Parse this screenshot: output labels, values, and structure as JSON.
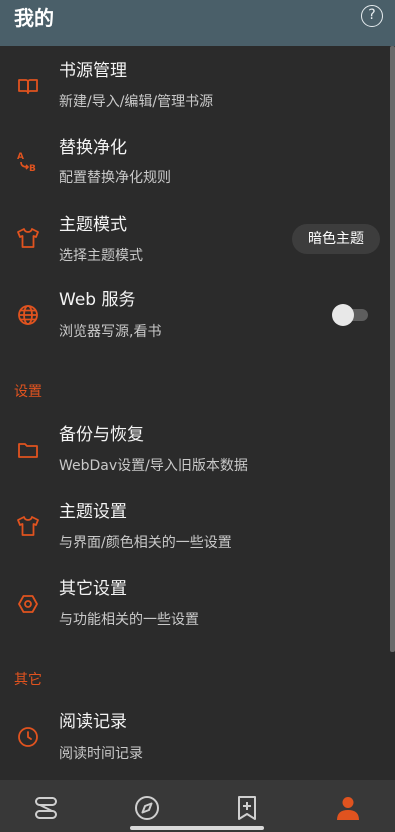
{
  "header": {
    "title": "我的",
    "help_icon": "help-circle-icon",
    "help_glyph": "?"
  },
  "items": [
    {
      "id": "book-source",
      "title": "书源管理",
      "subtitle": "新建/导入/编辑/管理书源",
      "icon": "book-icon"
    },
    {
      "id": "replace-purify",
      "title": "替换净化",
      "subtitle": "配置替换净化规则",
      "icon": "replace-ab-icon"
    },
    {
      "id": "theme-mode",
      "title": "主题模式",
      "subtitle": "选择主题模式",
      "icon": "shirt-icon",
      "value": "暗色主题"
    },
    {
      "id": "web-service",
      "title": "Web 服务",
      "subtitle": "浏览器写源,看书",
      "icon": "globe-icon",
      "toggle": false
    }
  ],
  "sections": {
    "settings": "设置",
    "other": "其它"
  },
  "settings_items": [
    {
      "id": "backup",
      "title": "备份与恢复",
      "subtitle": "WebDav设置/导入旧版本数据",
      "icon": "folder-icon"
    },
    {
      "id": "theme-settings",
      "title": "主题设置",
      "subtitle": "与界面/颜色相关的一些设置",
      "icon": "shirt-icon"
    },
    {
      "id": "other-settings",
      "title": "其它设置",
      "subtitle": "与功能相关的一些设置",
      "icon": "hexagon-settings-icon"
    }
  ],
  "other_items": [
    {
      "id": "read-record",
      "title": "阅读记录",
      "subtitle": "阅读时间记录",
      "icon": "clock-icon"
    }
  ],
  "bottom_nav": [
    {
      "id": "bookshelf",
      "icon": "bookshelf-icon",
      "active": false
    },
    {
      "id": "discover",
      "icon": "compass-icon",
      "active": false
    },
    {
      "id": "rss",
      "icon": "bookmark-add-icon",
      "active": false
    },
    {
      "id": "mine",
      "icon": "person-icon",
      "active": true
    }
  ],
  "colors": {
    "accent": "#e0531f",
    "header_bg": "#4a5f69",
    "background": "#2b2b2b",
    "nav_bg": "#383838"
  }
}
